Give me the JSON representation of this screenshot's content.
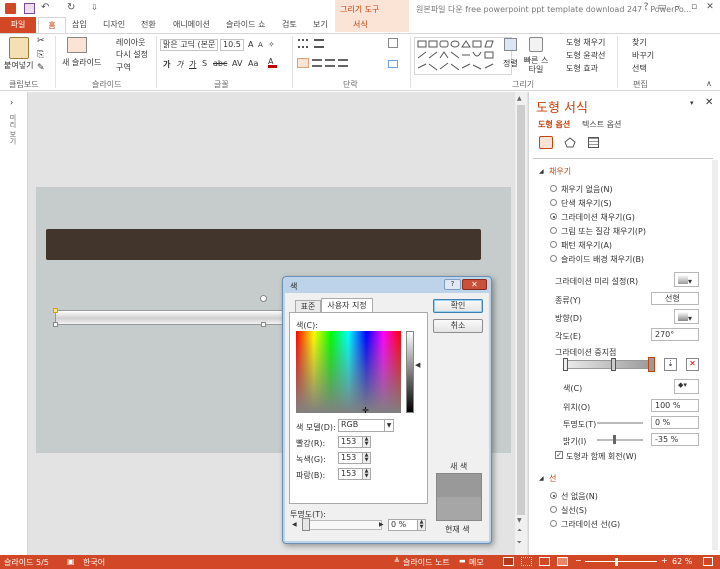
{
  "title_bar": {
    "doc_title": "원본파일 다운 free powerpoint ppt template download 247 - PowerPo...",
    "context_group": "그리기 도구",
    "window_buttons": [
      "?",
      "▭",
      "–",
      "▫",
      "✕"
    ]
  },
  "tabs": [
    "파일",
    "홈",
    "삽입",
    "디자인",
    "전환",
    "애니메이션",
    "슬라이드 쇼",
    "검토",
    "보기",
    "서식"
  ],
  "ribbon": {
    "clipboard": {
      "paste": "붙여넣기",
      "group": "클립보드"
    },
    "slides": {
      "new_slide": "새 슬라이드",
      "layout": "레이아웃",
      "reset": "다시 설정",
      "section": "구역",
      "group": "슬라이드"
    },
    "font": {
      "name": "맑은 고딕 (본문",
      "size": "10.5",
      "group": "글꼴"
    },
    "paragraph": {
      "group": "단락"
    },
    "drawing": {
      "arrange": "정렬",
      "quick_styles": "빠른 스타일",
      "fill": "도형 채우기",
      "outline": "도형 윤곽선",
      "effects": "도형 효과",
      "group": "그리기"
    },
    "editing": {
      "find": "찾기",
      "replace": "바꾸기",
      "select": "선택",
      "group": "편집"
    }
  },
  "thumbnail_pane_label": "미리 보기",
  "format_pane": {
    "title": "도형 서식",
    "tabs": [
      "도형 옵션",
      "텍스트 옵션"
    ],
    "fill_section": "채우기",
    "fill_options": [
      {
        "label": "채우기 없음(N)",
        "selected": false
      },
      {
        "label": "단색 채우기(S)",
        "selected": false
      },
      {
        "label": "그라데이션 채우기(G)",
        "selected": true
      },
      {
        "label": "그림 또는 질감 채우기(P)",
        "selected": false
      },
      {
        "label": "패턴 채우기(A)",
        "selected": false
      },
      {
        "label": "슬라이드 배경 채우기(B)",
        "selected": false
      }
    ],
    "preset_label": "그라데이션 미리 설정(R)",
    "type_label": "종류(Y)",
    "type_value": "선형",
    "direction_label": "방향(D)",
    "angle_label": "각도(E)",
    "angle_value": "270°",
    "stops_label": "그라데이션 중지점",
    "color_label": "색(C)",
    "position_label": "위치(O)",
    "position_value": "100 %",
    "transparency_label": "투명도(T)",
    "transparency_value": "0 %",
    "brightness_label": "밝기(I)",
    "brightness_value": "-35 %",
    "rotate_label": "도형과 함께 회전(W)",
    "rotate_checked": true,
    "line_section": "선",
    "line_options": [
      {
        "label": "선 없음(N)",
        "selected": true
      },
      {
        "label": "실선(S)",
        "selected": false
      },
      {
        "label": "그라데이션 선(G)",
        "selected": false
      }
    ]
  },
  "color_dialog": {
    "title": "색",
    "tabs": [
      "표준",
      "사용자 지정"
    ],
    "colors_label": "색(C):",
    "model_label": "색 모델(D):",
    "model_value": "RGB",
    "red_label": "빨강(R):",
    "red": "153",
    "green_label": "녹색(G):",
    "green": "153",
    "blue_label": "파랑(B):",
    "blue": "153",
    "transparency_label": "투명도(T):",
    "transparency_value": "0 %",
    "ok": "확인",
    "cancel": "취소",
    "new_label": "새 색",
    "current_label": "현재 색",
    "new_color": "#999999",
    "current_color": "#a6a6a6"
  },
  "status_bar": {
    "slide": "슬라이드 5/5",
    "language": "한국어",
    "notes": "슬라이드 노트",
    "comments": "메모",
    "zoom": "62 %"
  },
  "colors": {
    "accent": "#d24726",
    "banner": "#42352c",
    "slide_bg": "#c5cccb"
  }
}
